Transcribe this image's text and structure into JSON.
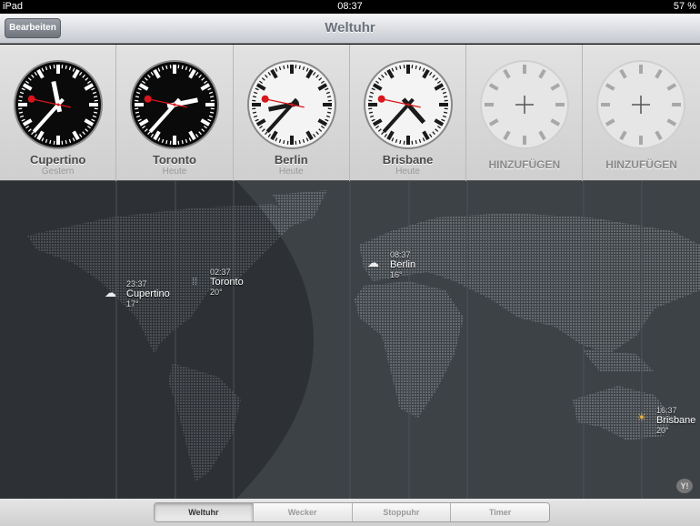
{
  "status": {
    "device": "iPad",
    "time": "08:37",
    "battery": "57 %"
  },
  "nav": {
    "edit": "Bearbeiten",
    "title": "Weltuhr"
  },
  "clocks": [
    {
      "city": "Cupertino",
      "day": "Gestern",
      "hour": 23,
      "minute": 37,
      "second": 47,
      "face": "dark"
    },
    {
      "city": "Toronto",
      "day": "Heute",
      "hour": 2,
      "minute": 37,
      "second": 47,
      "face": "dark"
    },
    {
      "city": "Berlin",
      "day": "Heute",
      "hour": 8,
      "minute": 37,
      "second": 47,
      "face": "light"
    },
    {
      "city": "Brisbane",
      "day": "Heute",
      "hour": 16,
      "minute": 37,
      "second": 47,
      "face": "light"
    }
  ],
  "add_label": "HINZUFÜGEN",
  "map_cities": [
    {
      "time": "23:37",
      "name": "Cupertino",
      "temp": "17°",
      "weather": "cloudy-icon"
    },
    {
      "time": "02:37",
      "name": "Toronto",
      "temp": "20°",
      "weather": "rain-icon"
    },
    {
      "time": "08:37",
      "name": "Berlin",
      "temp": "16°",
      "weather": "cloudy-icon"
    },
    {
      "time": "16:37",
      "name": "Brisbane",
      "temp": "20°",
      "weather": "partly-sunny-icon"
    }
  ],
  "yahoo": "Y!",
  "tabs": [
    "Weltuhr",
    "Wecker",
    "Stoppuhr",
    "Timer"
  ]
}
